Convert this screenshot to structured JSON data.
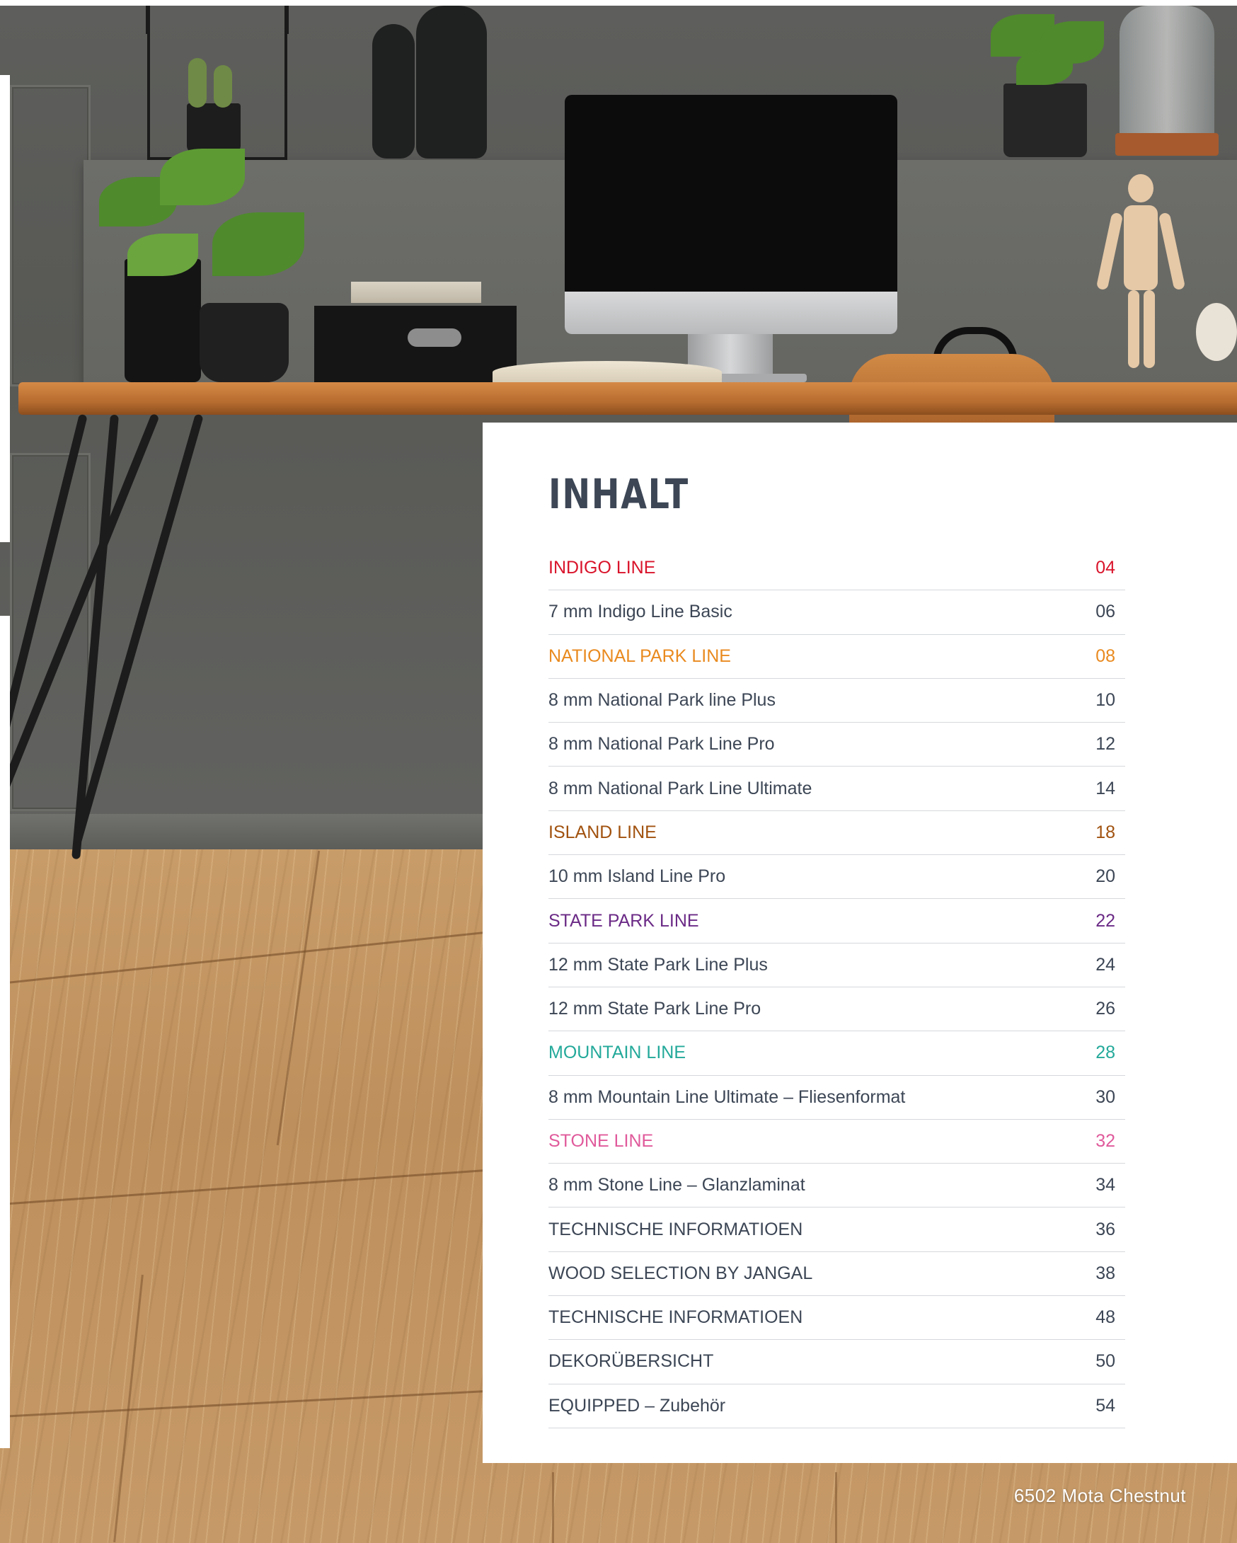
{
  "title": "INHALT",
  "colors": {
    "text": "#3c4655",
    "divider": "#d5d8dc",
    "indigo": "#d9142b",
    "national_park": "#e98a1f",
    "island": "#a1520f",
    "state_park": "#6b2a86",
    "mountain": "#23a99a",
    "stone": "#e05a9b"
  },
  "toc": [
    {
      "label": "INDIGO LINE",
      "page": "04",
      "accent": "#d9142b",
      "section": true
    },
    {
      "label": "7 mm Indigo Line Basic",
      "page": "06"
    },
    {
      "label": "NATIONAL PARK LINE",
      "page": "08",
      "accent": "#e98a1f",
      "section": true
    },
    {
      "label": "8 mm National Park line Plus",
      "page": "10"
    },
    {
      "label": "8 mm National Park Line Pro",
      "page": "12"
    },
    {
      "label": "8 mm National Park Line Ultimate",
      "page": "14"
    },
    {
      "label": "ISLAND LINE",
      "page": "18",
      "accent": "#a1520f",
      "section": true
    },
    {
      "label": "10 mm Island Line Pro",
      "page": "20"
    },
    {
      "label": "STATE PARK LINE",
      "page": "22",
      "accent": "#6b2a86",
      "section": true
    },
    {
      "label": "12 mm State Park Line Plus",
      "page": "24"
    },
    {
      "label": "12 mm State Park Line Pro",
      "page": "26"
    },
    {
      "label": "MOUNTAIN LINE",
      "page": "28",
      "accent": "#23a99a",
      "section": true
    },
    {
      "label": "8 mm Mountain Line Ultimate – Fliesenformat",
      "page": "30"
    },
    {
      "label": "STONE LINE",
      "page": "32",
      "accent": "#e05a9b",
      "section": true
    },
    {
      "label": "8 mm Stone Line – Glanzlaminat",
      "page": "34"
    },
    {
      "label": "TECHNISCHE INFORMATIOEN",
      "page": "36"
    },
    {
      "label": "WOOD SELECTION BY JANGAL",
      "page": "38"
    },
    {
      "label": "TECHNISCHE INFORMATIOEN",
      "page": "48"
    },
    {
      "label": "DEKORÜBERSICHT",
      "page": "50"
    },
    {
      "label": "EQUIPPED – Zubehör",
      "page": "54"
    }
  ],
  "caption": "6502 Mota Chestnut"
}
